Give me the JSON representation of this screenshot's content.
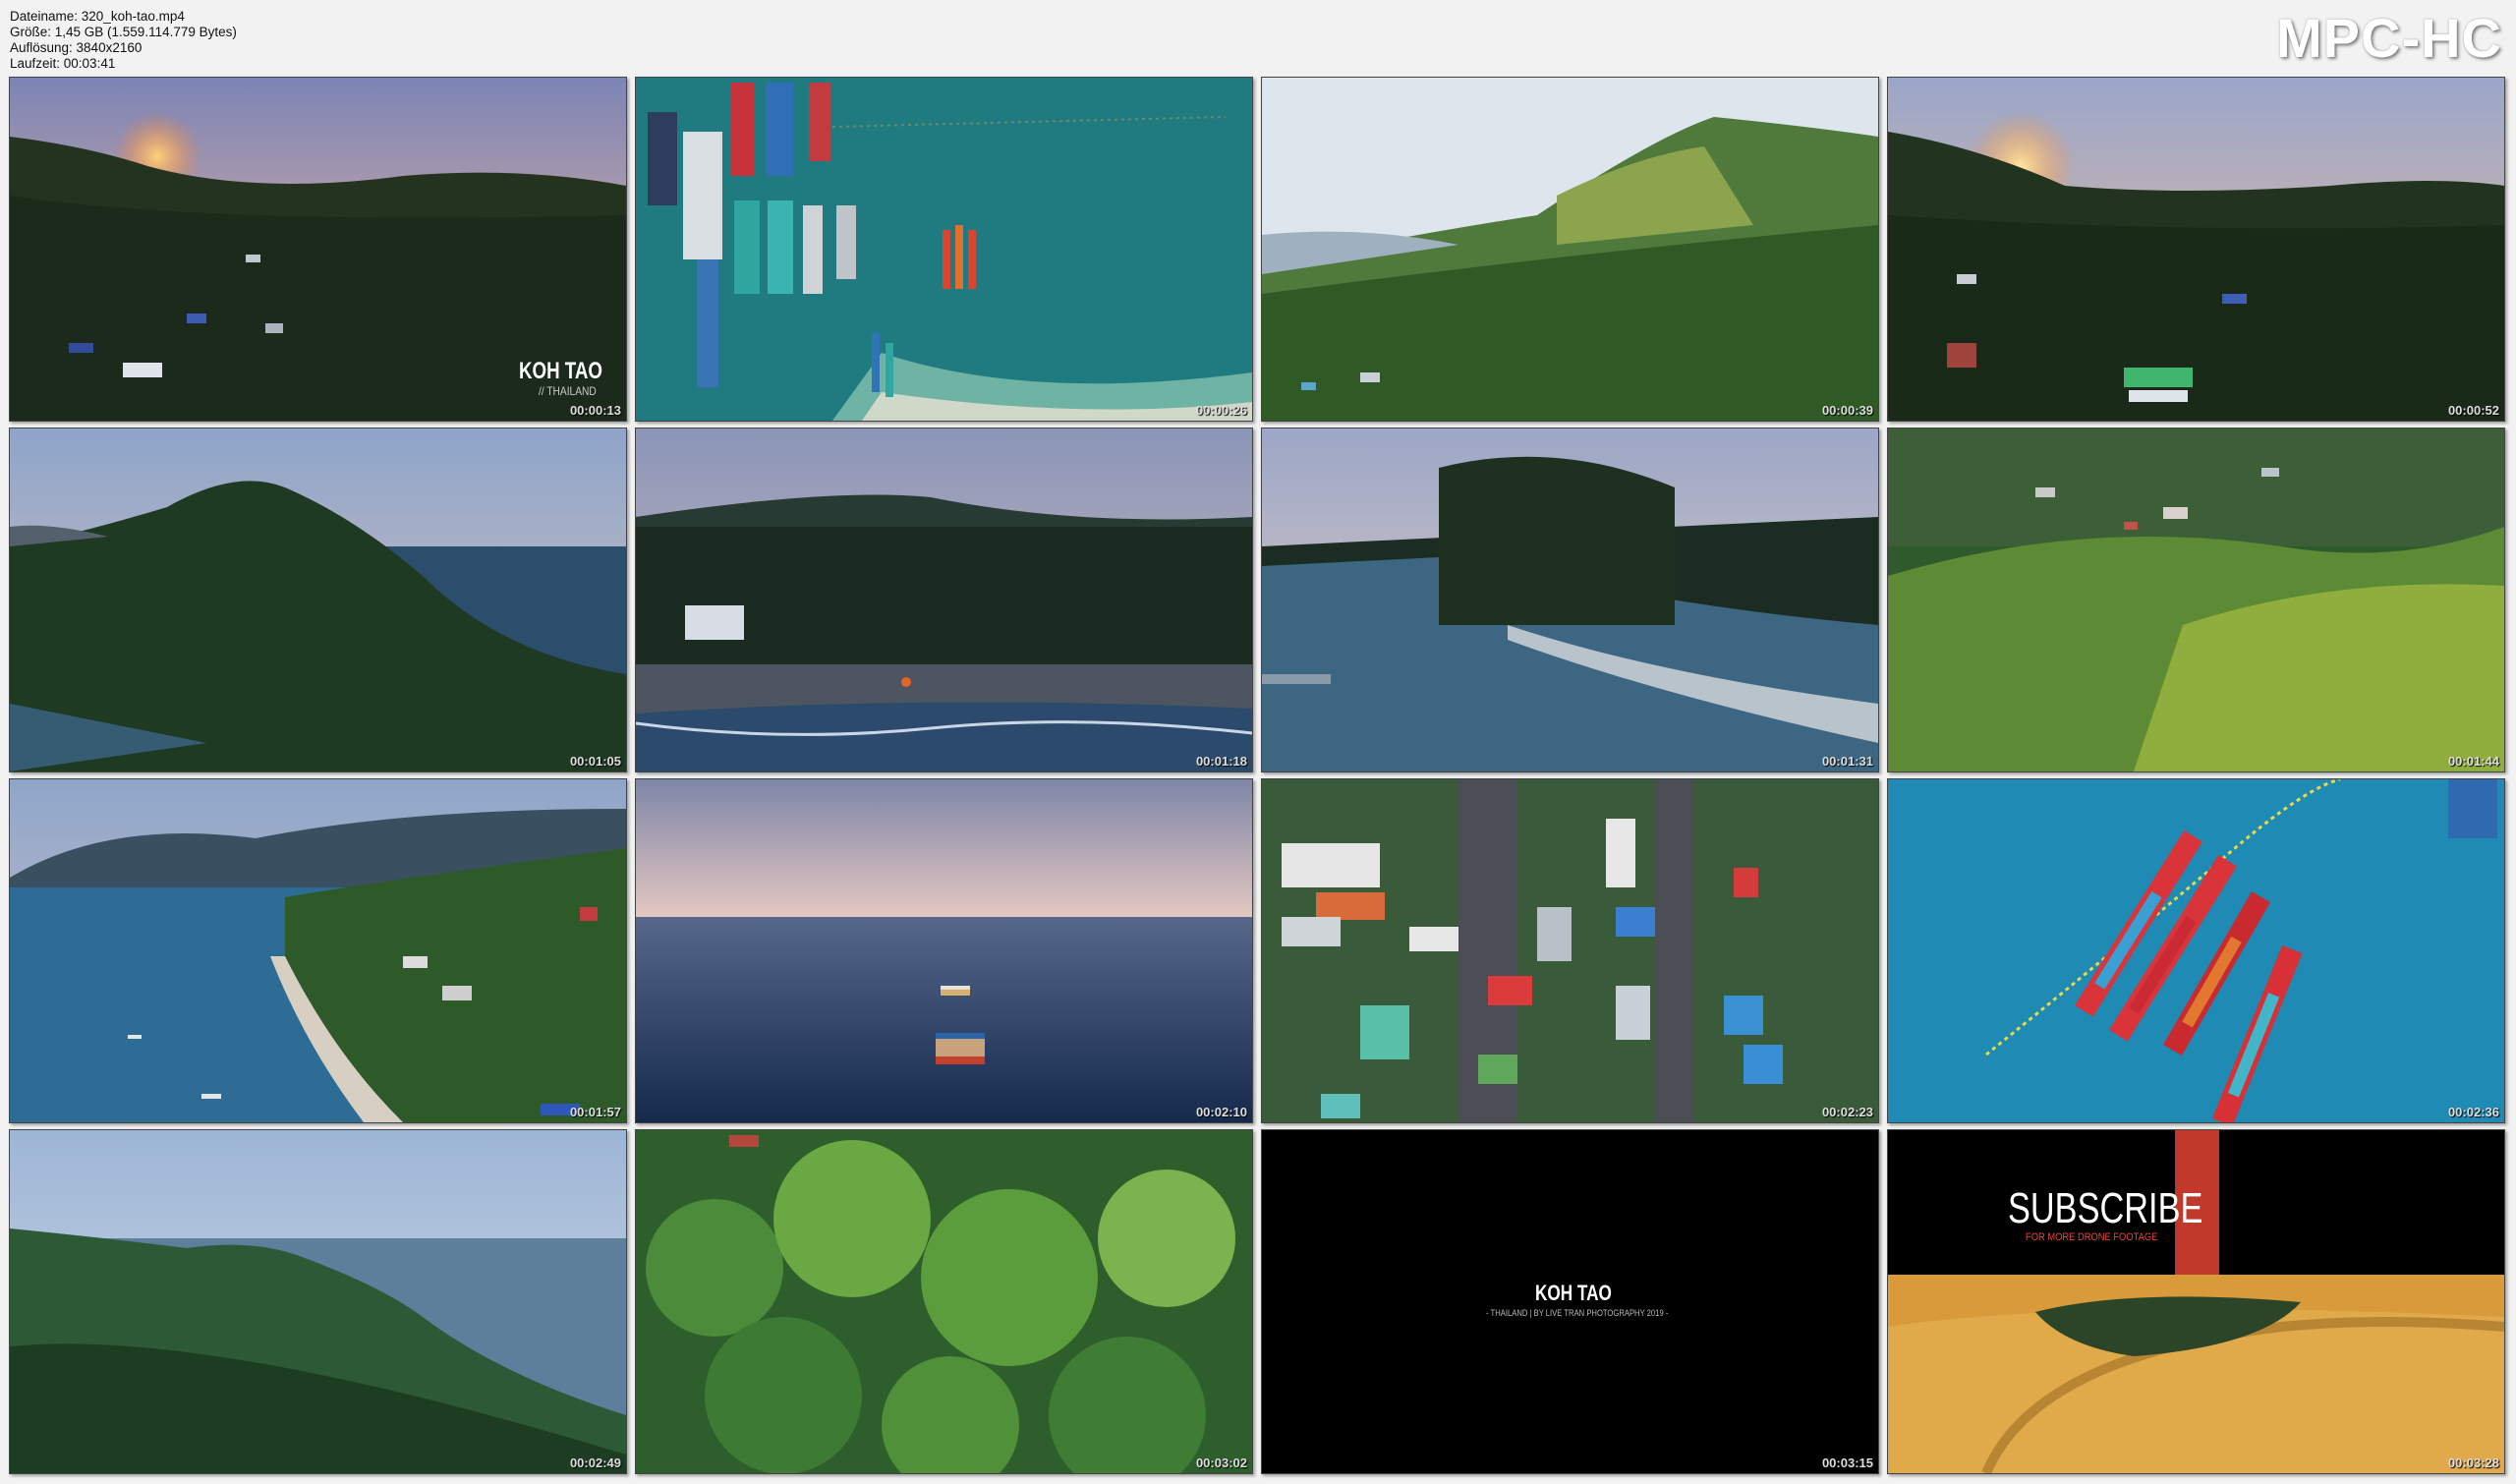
{
  "info": {
    "filename": "Dateiname: 320_koh-tao.mp4",
    "size": "Größe: 1,45 GB (1.559.114.779 Bytes)",
    "resolution": "Auflösung: 3840x2160",
    "duration": "Laufzeit: 00:03:41"
  },
  "logo": "MPC-HC",
  "thumbnails": [
    {
      "time": "00:00:13",
      "scene": "sunset-hills-village"
    },
    {
      "time": "00:00:26",
      "scene": "boats-pier-aerial"
    },
    {
      "time": "00:00:39",
      "scene": "green-mountain-hazy"
    },
    {
      "time": "00:00:52",
      "scene": "sunset-hills-village"
    },
    {
      "time": "00:01:05",
      "scene": "dark-hill-coast"
    },
    {
      "time": "00:01:18",
      "scene": "palm-beach"
    },
    {
      "time": "00:01:31",
      "scene": "bay-trees"
    },
    {
      "time": "00:01:44",
      "scene": "forest-village"
    },
    {
      "time": "00:01:57",
      "scene": "coast-bay-town"
    },
    {
      "time": "00:02:10",
      "scene": "sea-boat-dusk"
    },
    {
      "time": "00:02:23",
      "scene": "town-street-aerial"
    },
    {
      "time": "00:02:36",
      "scene": "red-longtail-boats"
    },
    {
      "time": "00:02:49",
      "scene": "misty-coast"
    },
    {
      "time": "00:03:02",
      "scene": "tree-canopy"
    },
    {
      "time": "00:03:15",
      "scene": "black-title-card"
    },
    {
      "time": "00:03:28",
      "scene": "subscribe-card"
    }
  ],
  "overlays": {
    "thumb1_title": "KOH TAO",
    "thumb1_sub": "// THAILAND",
    "card_title": "KOH TAO",
    "card_sub": "- THAILAND | BY LIVE TRAN PHOTOGRAPHY 2019 -",
    "subscribe": "SUBSCRIBE",
    "subscribe_sub": "FOR MORE DRONE FOOTAGE"
  },
  "colors": {
    "background": "#f2f2f2",
    "subscribe_red": "#c0392b"
  }
}
